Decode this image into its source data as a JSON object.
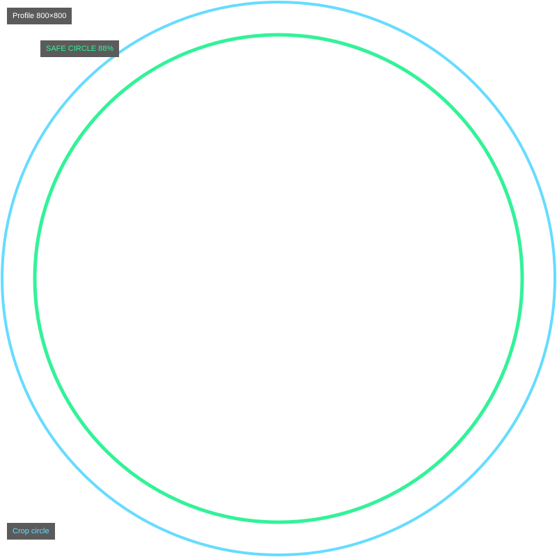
{
  "labels": {
    "profile": "Profile 800×800",
    "safe_circle": "SAFE CIRCLE 88%",
    "crop_circle": "Crop circle"
  },
  "guides": {
    "crop_circle": {
      "diameter_fraction": 1.0,
      "color": "#66dcff"
    },
    "safe_circle": {
      "diameter_fraction": 0.88,
      "color": "#33f298"
    }
  }
}
